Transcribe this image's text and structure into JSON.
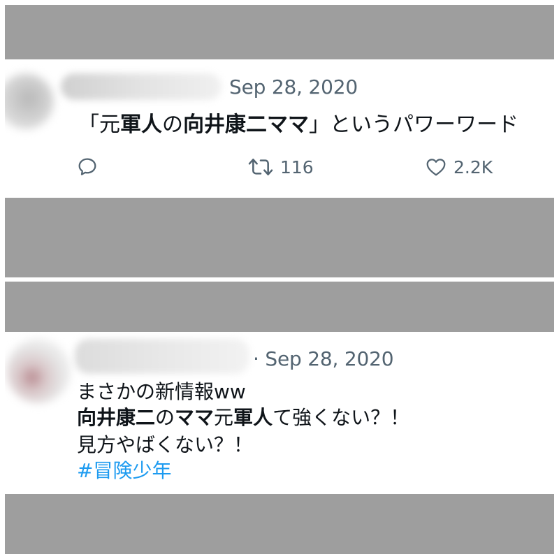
{
  "tweet1": {
    "date": "Sep 28, 2020",
    "text_parts": [
      {
        "text": "「元",
        "bold": false
      },
      {
        "text": "軍人",
        "bold": true
      },
      {
        "text": "の",
        "bold": false
      },
      {
        "text": "向井康二ママ",
        "bold": true
      },
      {
        "text": "」というパワーワード",
        "bold": false
      }
    ],
    "actions": {
      "reply_icon": "reply-icon",
      "retweet_icon": "retweet-icon",
      "retweet_count": "116",
      "like_icon": "heart-icon",
      "like_count": "2.2K"
    }
  },
  "tweet2": {
    "date_prefix": "·",
    "date": "Sep 28, 2020",
    "line1": "まさかの新情報ww",
    "line2_parts": [
      {
        "text": "向井康二",
        "bold": true
      },
      {
        "text": "の",
        "bold": false
      },
      {
        "text": "ママ",
        "bold": true
      },
      {
        "text": "元",
        "bold": false
      },
      {
        "text": "軍人",
        "bold": true
      },
      {
        "text": "て強くない？！",
        "bold": false
      }
    ],
    "line3": "見方やばくない？！",
    "hashtag": "#冒険少年"
  },
  "colors": {
    "background_gray": "#9e9e9e",
    "text": "#0f1419",
    "muted": "#536471",
    "link": "#1d9bf0"
  }
}
